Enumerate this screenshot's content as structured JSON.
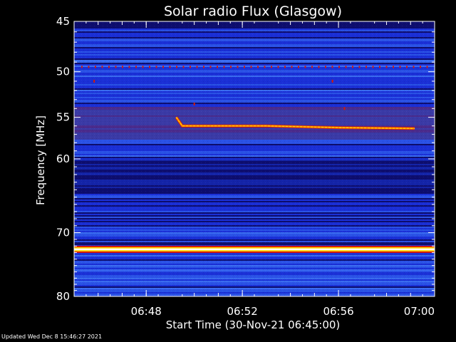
{
  "chart_data": {
    "type": "heatmap",
    "title": "Solar radio Flux (Glasgow)",
    "xlabel": "Start Time (30-Nov-21 06:45:00)",
    "ylabel": "Frequency [MHz]",
    "x_unit": "time (HH:MM)",
    "xlim": [
      "06:45",
      "07:00"
    ],
    "x_ticks": [
      "06:48",
      "06:52",
      "06:56",
      "07:00"
    ],
    "y_unit": "MHz",
    "ylim": [
      45,
      80
    ],
    "y_scale": "log",
    "y_ticks": [
      45,
      50,
      55,
      60,
      70,
      80
    ],
    "colormap": [
      "#000000",
      "#0d0d6e",
      "#1a2fd6",
      "#3a6cf0",
      "#7a0a0a",
      "#d21a0a",
      "#ff8c00",
      "#ffd400",
      "#ffffff"
    ],
    "features": [
      {
        "kind": "bright-band",
        "frequency": 72.5,
        "intensity": "max"
      },
      {
        "kind": "dotted-band",
        "frequency": 49.5,
        "intensity": "high"
      },
      {
        "kind": "drifting-trace",
        "intensity": "high",
        "points": [
          {
            "t": "06:49:15",
            "f": 55.0
          },
          {
            "t": "06:49:30",
            "f": 56.0
          },
          {
            "t": "06:50:00",
            "f": 56.0
          },
          {
            "t": "06:53:00",
            "f": 56.0
          },
          {
            "t": "06:56:00",
            "f": 56.2
          },
          {
            "t": "06:59:10",
            "f": 56.3
          }
        ]
      },
      {
        "kind": "spot",
        "t": "06:45:50",
        "f": 51.0
      },
      {
        "kind": "spot",
        "t": "06:50:00",
        "f": 53.5
      },
      {
        "kind": "spot",
        "t": "06:55:45",
        "f": 51.0
      },
      {
        "kind": "spot",
        "t": "06:56:15",
        "f": 54.0
      }
    ]
  },
  "footer": {
    "updated_text": "Updated Wed Dec  8 15:46:27 2021"
  }
}
